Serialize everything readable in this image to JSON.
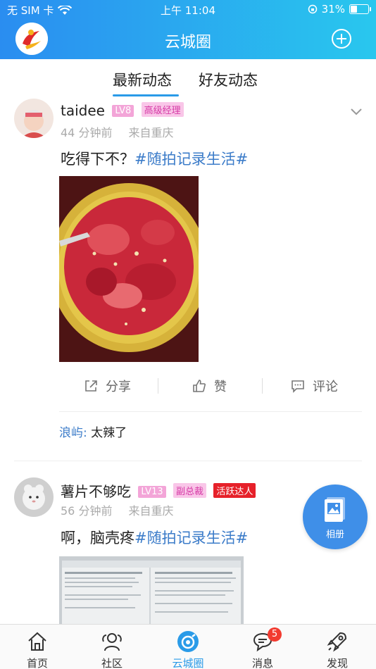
{
  "status_bar": {
    "carrier": "无 SIM 卡",
    "time": "上午 11:04",
    "battery_pct": "31%"
  },
  "header": {
    "title": "云城圈"
  },
  "tabs": [
    {
      "label": "最新动态",
      "active": true
    },
    {
      "label": "好友动态",
      "active": false
    }
  ],
  "posts": [
    {
      "user": "taidee",
      "level": "LV8",
      "role": "高级经理",
      "time_ago": "44 分钟前",
      "location": "来自重庆",
      "text": "吃得下不？",
      "hashtag": "#随拍记录生活#",
      "actions": {
        "share": "分享",
        "like": "赞",
        "comment": "评论"
      },
      "comments": [
        {
          "user": "浪屿:",
          "text": "太辣了"
        }
      ]
    },
    {
      "user": "薯片不够吃",
      "level": "LV13",
      "role": "副总裁",
      "badge": "活跃达人",
      "time_ago": "56 分钟前",
      "location": "来自重庆",
      "text": "啊，脑壳疼",
      "hashtag": "#随拍记录生活#"
    }
  ],
  "floating": {
    "album_label": "相册"
  },
  "tabbar": [
    {
      "label": "首页",
      "icon": "home-icon"
    },
    {
      "label": "社区",
      "icon": "community-icon"
    },
    {
      "label": "云城圈",
      "icon": "cloud-circle-icon",
      "active": true
    },
    {
      "label": "消息",
      "icon": "message-icon",
      "badge": "5"
    },
    {
      "label": "发现",
      "icon": "rocket-icon"
    }
  ],
  "colors": {
    "header_gradient_start": "#2a8df0",
    "header_gradient_end": "#29c7ee",
    "accent": "#2a9be8",
    "hashtag": "#3c7cc9",
    "badge_red": "#f23b30"
  }
}
